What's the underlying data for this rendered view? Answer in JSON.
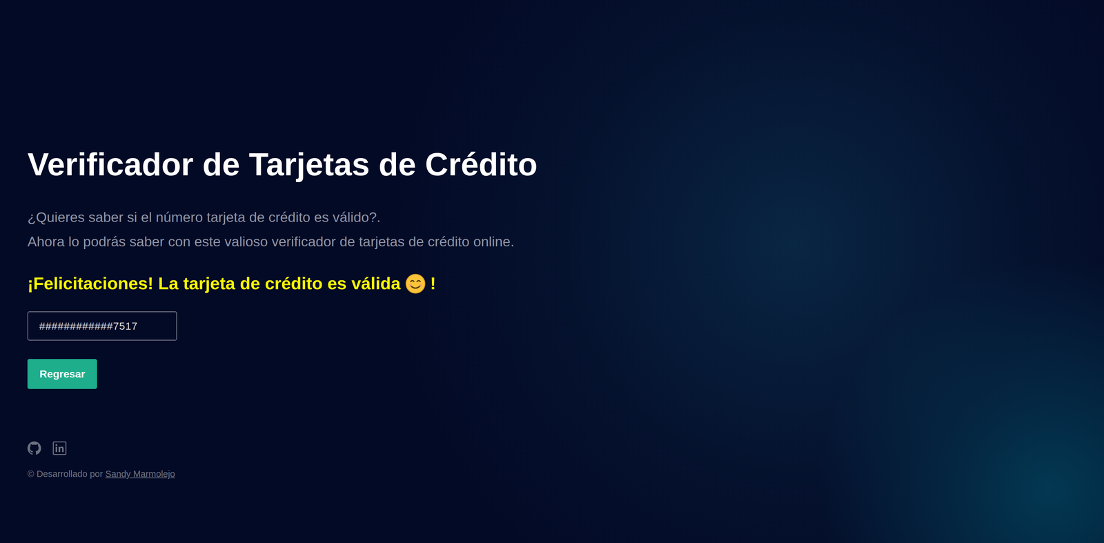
{
  "header": {
    "title": "Verificador de Tarjetas de Crédito",
    "subtitle_lines": [
      "¿Quieres saber si el número tarjeta de crédito es válido?.",
      "Ahora lo podrás saber con este valioso verificador de tarjetas de crédito online."
    ]
  },
  "result": {
    "message": "¡Felicitaciones! La tarjeta de crédito es válida",
    "suffix": "!"
  },
  "card": {
    "value": "############7517"
  },
  "buttons": [
    "Regresar"
  ],
  "footer": {
    "prefix": "© Desarrollado por",
    "author": "Sandy Marmolejo"
  }
}
